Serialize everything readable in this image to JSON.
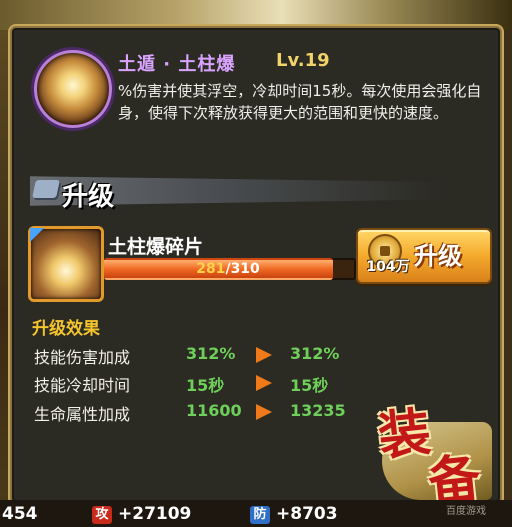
{
  "skill": {
    "name": "土遁 · 土柱爆",
    "level": "Lv.19",
    "description": "%伤害并使其浮空，冷却时间15秒。每次使用会强化自身，使得下次释放获得更大的范围和更快的速度。"
  },
  "upgrade_section": {
    "title": "升级"
  },
  "fragment": {
    "name": "土柱爆碎片",
    "current": "281",
    "separator": "/",
    "required": "310",
    "progress_fraction": 0.906
  },
  "upgrade_button": {
    "cost": "104万",
    "label": "升级"
  },
  "effects": {
    "title": "升级效果",
    "rows": [
      {
        "label": "技能伤害加成",
        "from": "312%",
        "to": "312%"
      },
      {
        "label": "技能冷却时间",
        "from": "15秒",
        "to": "15秒"
      },
      {
        "label": "生命属性加成",
        "from": "11600",
        "to": "13235"
      }
    ]
  },
  "equip_badge": {
    "char1": "装",
    "char2": "备"
  },
  "watermark": "百度游戏",
  "bottom_stats": {
    "left_value": "454",
    "attack_label": "攻",
    "attack_value": "+27109",
    "defense_label": "防",
    "defense_value": "+8703"
  },
  "colors": {
    "skill_name": "#d9a3ff",
    "level": "#f1d36a",
    "effect_title": "#f4c52c",
    "value_green": "#6ed05a",
    "arrow": "#f07a1a",
    "progress": "#f06a24"
  }
}
